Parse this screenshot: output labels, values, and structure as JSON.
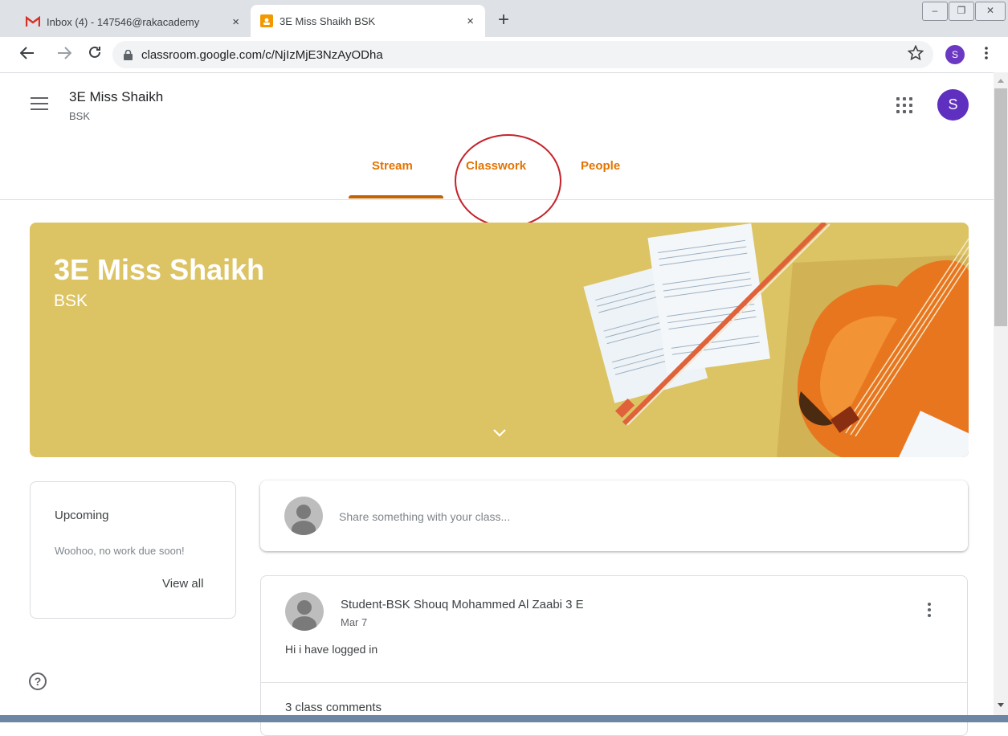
{
  "browser": {
    "tabs": [
      {
        "label": "Inbox (4) - 147546@rakacademy",
        "icon": "gmail-icon",
        "close": "×"
      },
      {
        "label": "3E Miss Shaikh BSK",
        "icon": "classroom-icon",
        "close": "×",
        "active": true
      }
    ],
    "new_tab": "+",
    "window_buttons": [
      "–",
      "❐",
      "✕"
    ],
    "url": "classroom.google.com/c/NjIzMjE3NzAyODha",
    "profile_initial": "S"
  },
  "classroom": {
    "class_name": "3E Miss Shaikh",
    "class_section": "BSK",
    "user_initial": "S",
    "nav_tabs": [
      "Stream",
      "Classwork",
      "People"
    ],
    "active_tab": "Stream",
    "accent_color": "#e37400",
    "banner": {
      "title": "3E Miss Shaikh",
      "section": "BSK",
      "color": "#dcc464"
    },
    "upcoming": {
      "title": "Upcoming",
      "text": "Woohoo, no work due soon!",
      "view_all": "View all"
    },
    "share_placeholder": "Share something with your class...",
    "post": {
      "author": "Student-BSK Shouq Mohammed Al Zaabi 3 E",
      "date": "Mar 7",
      "body": "Hi i have logged in",
      "comments": "3 class comments"
    },
    "help_glyph": "?"
  }
}
